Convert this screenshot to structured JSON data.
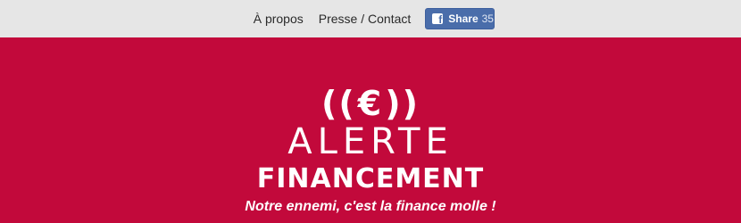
{
  "nav": {
    "links": [
      {
        "label": "À propos"
      },
      {
        "label": "Presse / Contact"
      }
    ],
    "share": {
      "icon": "facebook-icon",
      "label": "Share",
      "count": "35",
      "color": "#4a6daa"
    }
  },
  "hero": {
    "background_color": "#c2093b",
    "logo_symbol_left": "((",
    "logo_symbol_euro": "€",
    "logo_symbol_right": "))",
    "logo_line1": "ALERTE",
    "logo_line2": "FINANCEMENT",
    "tagline": "Notre ennemi, c'est la finance molle !"
  }
}
